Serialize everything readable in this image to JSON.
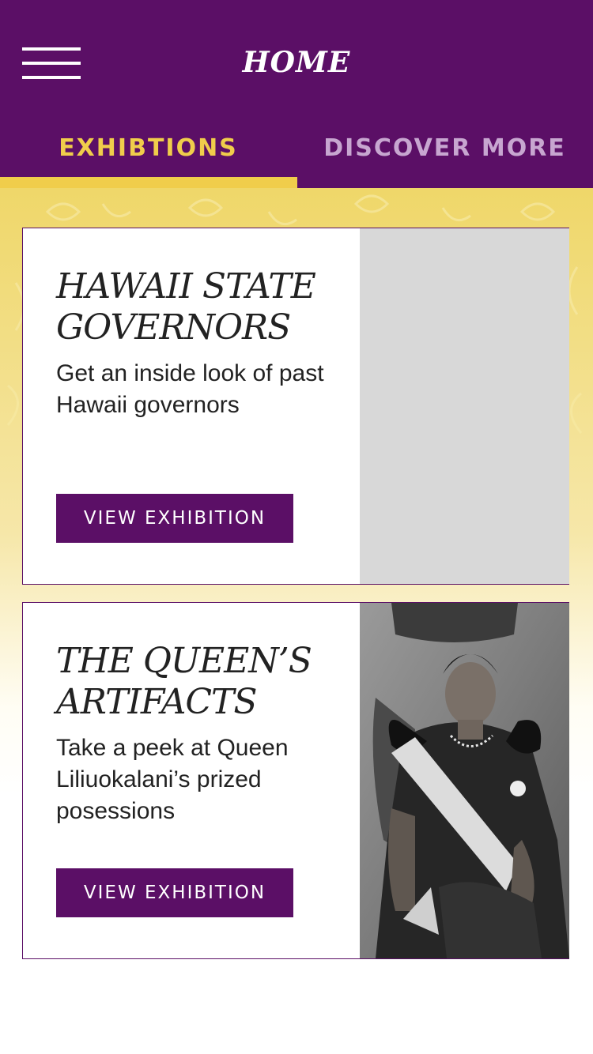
{
  "header": {
    "title": "HOME",
    "menu_icon": "hamburger-menu-icon",
    "background_color": "#5b0f66"
  },
  "tabs": [
    {
      "label": "EXHIBTIONS",
      "active": true,
      "color": "#f0cd4b"
    },
    {
      "label": "DISCOVER MORE",
      "active": false,
      "color": "#c7a6d0"
    }
  ],
  "exhibitions": [
    {
      "title": "HAWAII STATE GOVERNORS",
      "description": "Get an inside look of past Hawaii governors",
      "button_label": "VIEW EXHIBITION",
      "image": "placeholder-image"
    },
    {
      "title": "THE QUEEN’S ARTIFACTS",
      "description": "Take a peek at Queen Liliuokalani’s  prized posessions",
      "button_label": "VIEW EXHIBITION",
      "image": "queen-portrait-photo"
    }
  ],
  "colors": {
    "brand_purple": "#5b0f66",
    "accent_gold": "#f0cd4b"
  }
}
